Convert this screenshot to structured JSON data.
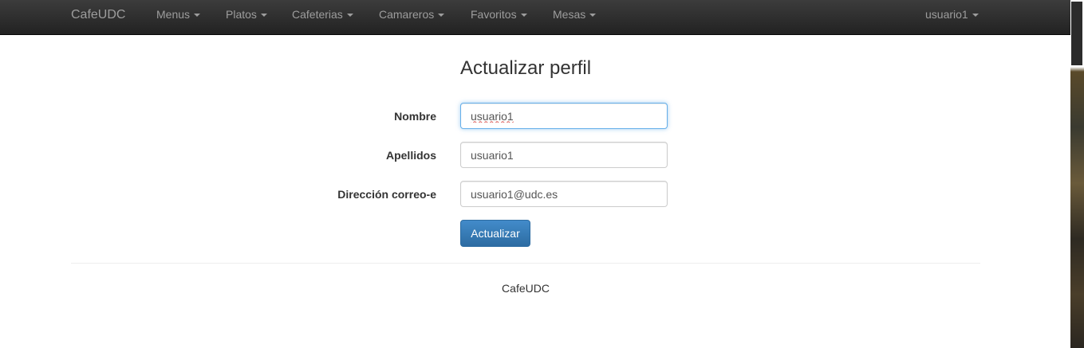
{
  "navbar": {
    "brand": "CafeUDC",
    "menus": [
      {
        "label": "Menus"
      },
      {
        "label": "Platos"
      },
      {
        "label": "Cafeterias"
      },
      {
        "label": "Camareros"
      },
      {
        "label": "Favoritos"
      },
      {
        "label": "Mesas"
      }
    ],
    "user_menu": "usuario1"
  },
  "form": {
    "title": "Actualizar perfil",
    "fields": {
      "nombre": {
        "label": "Nombre",
        "value": "usuario1"
      },
      "apellidos": {
        "label": "Apellidos",
        "value": "usuario1"
      },
      "email": {
        "label": "Dirección correo-e",
        "value": "usuario1@udc.es"
      }
    },
    "submit_label": "Actualizar"
  },
  "footer": {
    "text": "CafeUDC"
  },
  "colors": {
    "navbar_bg": "#222222",
    "nav_text": "#9d9d9d",
    "primary_button": "#428bca",
    "focus_border": "#66afe9"
  }
}
